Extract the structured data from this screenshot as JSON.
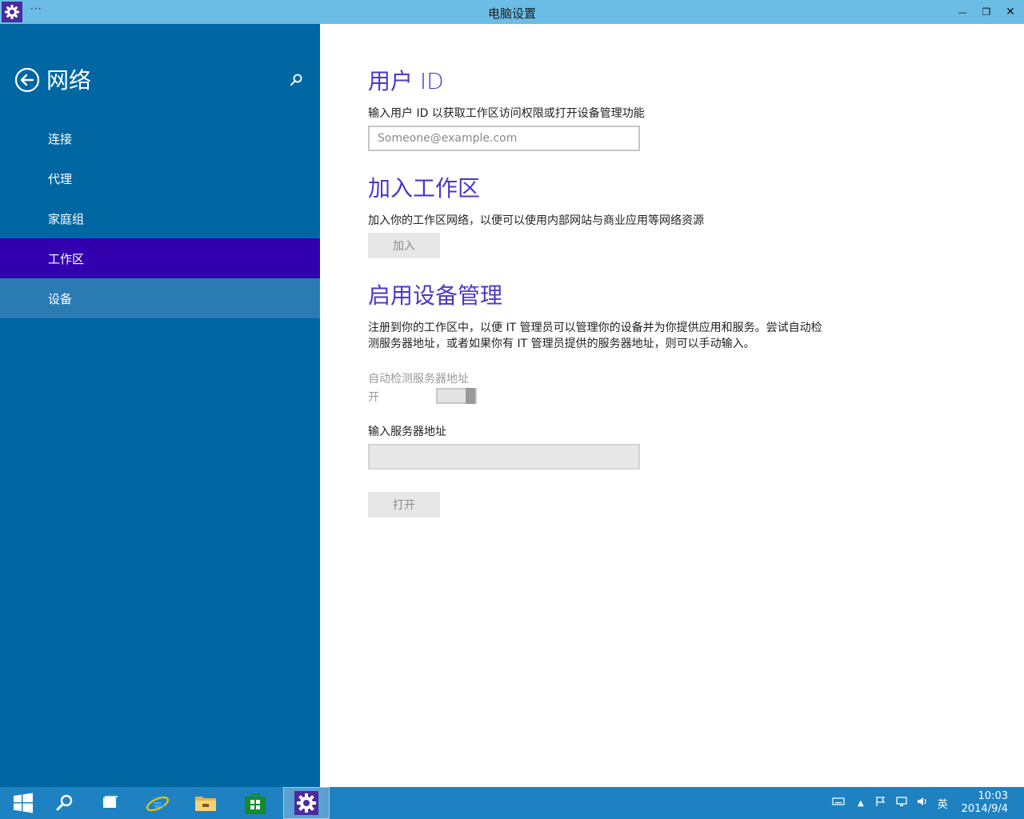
{
  "window": {
    "title": "电脑设置",
    "menu_glyph": "···",
    "minimize_glyph": "—",
    "restore_glyph": "❐",
    "close_glyph": "✕"
  },
  "sidebar": {
    "section_title": "网络",
    "items": [
      {
        "label": "连接",
        "state": "normal"
      },
      {
        "label": "代理",
        "state": "normal"
      },
      {
        "label": "家庭组",
        "state": "normal"
      },
      {
        "label": "工作区",
        "state": "selected"
      },
      {
        "label": "设备",
        "state": "hover"
      }
    ]
  },
  "main": {
    "user_id": {
      "heading": "用户 ID",
      "description": "输入用户 ID 以获取工作区访问权限或打开设备管理功能",
      "input_value": "",
      "input_placeholder": "Someone@example.com"
    },
    "join_workplace": {
      "heading": "加入工作区",
      "description": "加入你的工作区网络，以便可以使用内部网站与商业应用等网络资源",
      "button_label": "加入"
    },
    "device_management": {
      "heading": "启用设备管理",
      "description_line1": "注册到你的工作区中，以便 IT 管理员可以管理你的设备并为你提供应用和服务。尝试自动检",
      "description_line2": "测服务器地址，或者如果你有 IT 管理员提供的服务器地址，则可以手动输入。",
      "auto_detect_label": "自动检测服务器地址",
      "toggle_state_label": "开",
      "toggle_on": true,
      "server_address_label": "输入服务器地址",
      "server_address_value": "",
      "open_button_label": "打开"
    }
  },
  "taskbar": {
    "items": [
      "start-button",
      "search-button",
      "task-view-button",
      "internet-explorer",
      "file-explorer",
      "store",
      "pc-settings"
    ],
    "active_item": "pc-settings",
    "tray": {
      "ime_label": "英",
      "time": "10:03",
      "date": "2014/9/4"
    }
  },
  "colors": {
    "sidebar_bg": "#0067a3",
    "sidebar_selected": "#3300b0",
    "sidebar_hover": "#2b7bb3",
    "heading": "#4b38c9",
    "titlebar": "#6bbde6",
    "taskbar": "#1e82c2"
  }
}
